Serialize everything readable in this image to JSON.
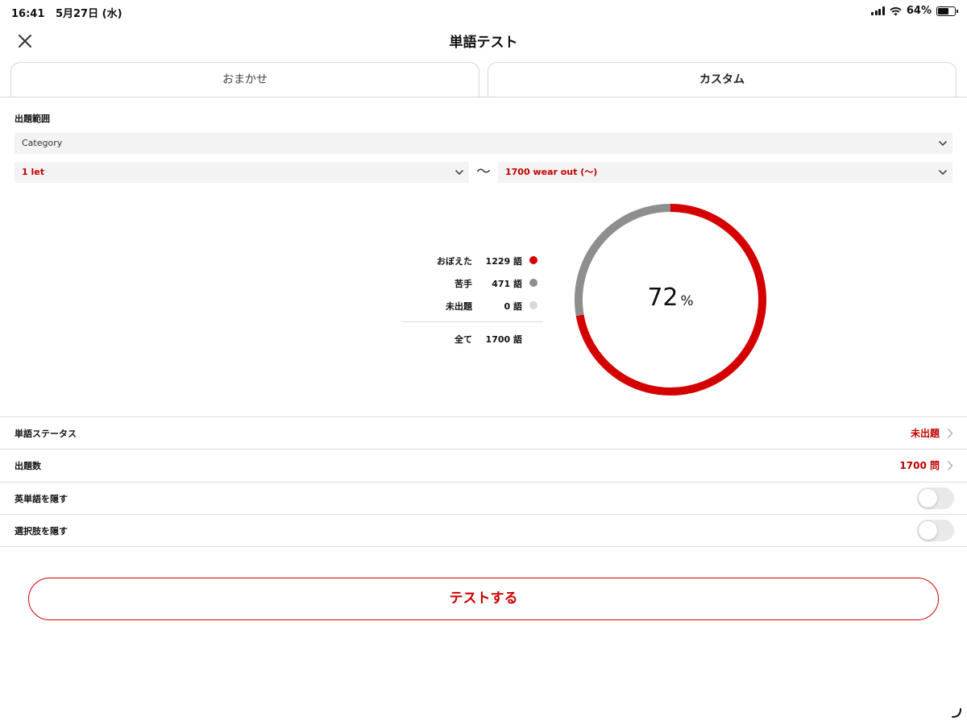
{
  "status_bar": {
    "time": "16:41",
    "date": "5月27日 (水)",
    "battery": "64%",
    "battery_level": 0.64
  },
  "header": {
    "title": "単語テスト",
    "close_icon": "close-icon"
  },
  "tabs": [
    {
      "label": "おまかせ",
      "selected": false
    },
    {
      "label": "カスタム",
      "selected": true
    }
  ],
  "range": {
    "label": "出題範囲",
    "category": "Category",
    "start": "1 let",
    "separator": "〜",
    "end": "1700 wear out (〜)"
  },
  "stats": {
    "remembered": {
      "label": "おぼえた",
      "value": "1229 語",
      "count": 1229,
      "color": "#d40000"
    },
    "weak": {
      "label": "苦手",
      "value": "471 語",
      "count": 471,
      "color": "#8e8e8e"
    },
    "unasked": {
      "label": "未出題",
      "value": "0 語",
      "count": 0,
      "color": "#d9d9d9"
    },
    "total": {
      "label": "全て",
      "value": "1700 語",
      "count": 1700
    }
  },
  "progress": {
    "percent": "72",
    "unit": "%"
  },
  "settings": {
    "word_status": {
      "label": "単語ステータス",
      "value": "未出題"
    },
    "question_count": {
      "label": "出題数",
      "value": "1700 問"
    },
    "hide_english": {
      "label": "英単語を隠す",
      "on": false
    },
    "hide_choices": {
      "label": "選択肢を隠す",
      "on": false
    }
  },
  "action": {
    "label": "テストする"
  },
  "colors": {
    "accent": "#cc0000",
    "weak": "#8e8e8e",
    "divider": "#dcdcdc"
  }
}
